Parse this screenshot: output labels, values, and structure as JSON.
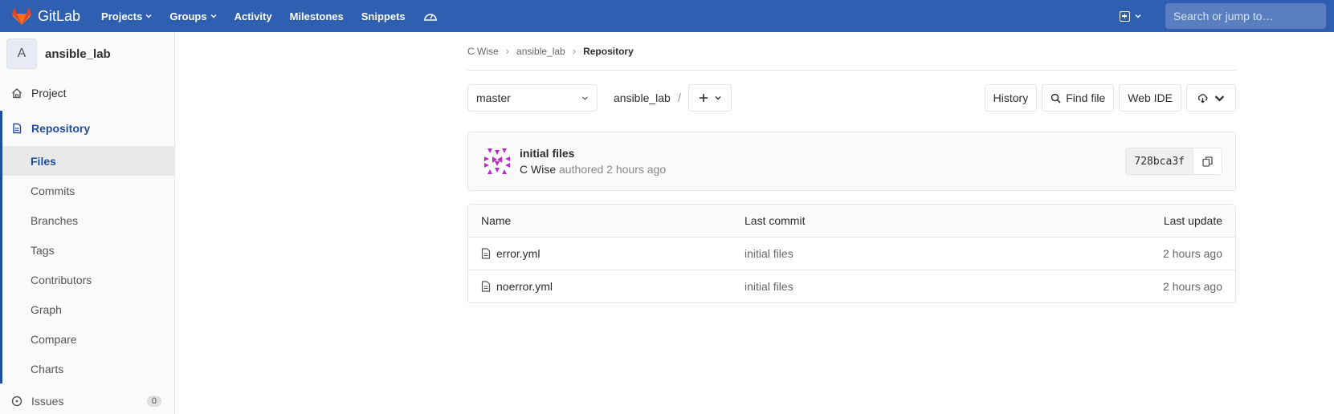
{
  "topnav": {
    "brand": "GitLab",
    "links": [
      "Projects",
      "Groups",
      "Activity",
      "Milestones",
      "Snippets"
    ],
    "search_placeholder": "Search or jump to…"
  },
  "sidebar": {
    "project_initial": "A",
    "project_name": "ansible_lab",
    "items": [
      {
        "label": "Project",
        "icon": "home-icon"
      },
      {
        "label": "Repository",
        "icon": "doc-icon"
      }
    ],
    "repository_subitems": [
      "Files",
      "Commits",
      "Branches",
      "Tags",
      "Contributors",
      "Graph",
      "Compare",
      "Charts"
    ],
    "issues_label": "Issues",
    "issues_count": "0"
  },
  "breadcrumb": [
    "C Wise",
    "ansible_lab",
    "Repository"
  ],
  "toolbar": {
    "branch": "master",
    "path_root": "ansible_lab",
    "path_sep": "/",
    "history": "History",
    "find_file": "Find file",
    "web_ide": "Web IDE"
  },
  "commit": {
    "title": "initial files",
    "author": "C Wise",
    "meta": " authored 2 hours ago",
    "sha": "728bca3f"
  },
  "tree": {
    "headers": [
      "Name",
      "Last commit",
      "Last update"
    ],
    "rows": [
      {
        "name": "error.yml",
        "last_commit": "initial files",
        "last_update": "2 hours ago"
      },
      {
        "name": "noerror.yml",
        "last_commit": "initial files",
        "last_update": "2 hours ago"
      }
    ]
  },
  "colors": {
    "nav_bg": "#2f5fb0",
    "accent": "#1f4e9e"
  }
}
